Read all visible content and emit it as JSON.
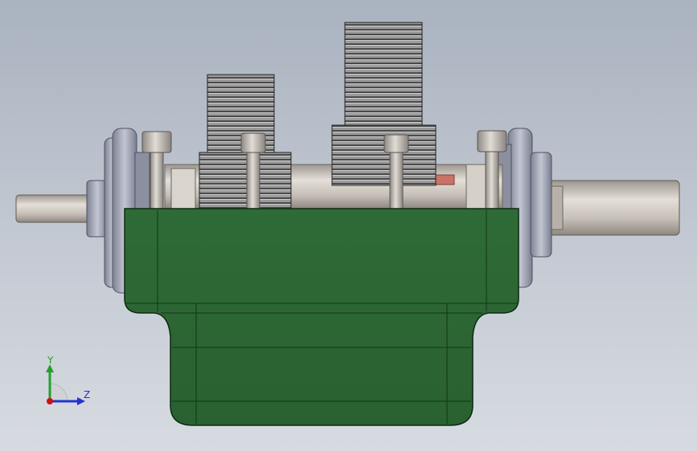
{
  "view": {
    "background_top": "#a9b2bf",
    "background_bottom": "#d7dbe1"
  },
  "model": {
    "housing_color": "#2f6a38",
    "housing_edge": "#0e2a12",
    "gear_color": "#8a8a8a",
    "shaft_color": "#c9c3bb",
    "bearing_color": "#9ea3b2",
    "bolt_color": "#b9b3ad",
    "accent_color": "#c87366"
  },
  "triad": {
    "y_label": "Y",
    "z_label": "Z",
    "y_color": "#22a02a",
    "z_color": "#2233cc",
    "origin_color": "#cc1111"
  }
}
